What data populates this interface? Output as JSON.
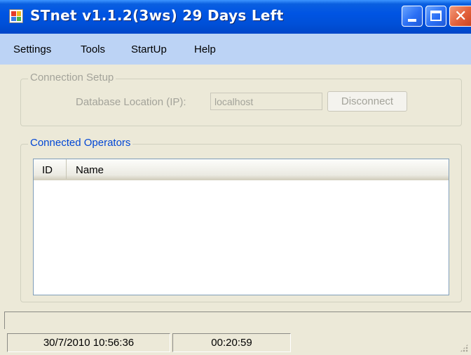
{
  "window": {
    "title": "STnet v1.1.2(3ws) 29 Days Left",
    "icon": "app-window-icon",
    "controls": {
      "minimize": "minimize-icon",
      "maximize": "maximize-icon",
      "close": "close-icon"
    },
    "colors": {
      "titlebar": "#0054e3",
      "menubar": "#bcd3f5",
      "close": "#e2603a"
    }
  },
  "menu": {
    "items": [
      {
        "label": "Settings"
      },
      {
        "label": "Tools"
      },
      {
        "label": "StartUp"
      },
      {
        "label": "Help"
      }
    ]
  },
  "connection_setup": {
    "legend": "Connection Setup",
    "db_label": "Database Location (IP):",
    "ip_value": "localhost",
    "disconnect_label": "Disconnect"
  },
  "operators": {
    "legend": "Connected Operators",
    "columns": [
      "ID",
      "Name"
    ],
    "rows": []
  },
  "status": {
    "datetime": "30/7/2010 10:56:36",
    "elapsed": "00:20:59"
  }
}
